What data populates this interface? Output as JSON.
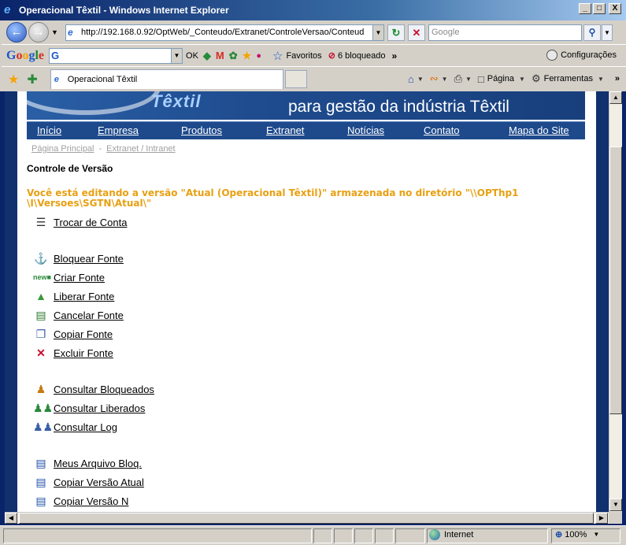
{
  "window": {
    "title": "Operacional Têxtil - Windows Internet Explorer",
    "minimize": "_",
    "maximize": "□",
    "close": "X"
  },
  "addressbar": {
    "url": "http://192.168.0.92/OptWeb/_Conteudo/Extranet/ControleVersao/Conteud",
    "search_placeholder": "Google"
  },
  "googlebar": {
    "ok_label": "OK",
    "favorites_label": "Favoritos",
    "blocked_label": "6 bloqueado",
    "more_label": "»",
    "settings_label": "Configurações"
  },
  "tabbar": {
    "tab_title": "Operacional Têxtil",
    "page_label": "Página",
    "tools_label": "Ferramentas",
    "more_label": "»"
  },
  "site": {
    "logo_text": "Têxtil",
    "slogan": "para gestão da indústria Têxtil",
    "nav": [
      "Início",
      "Empresa",
      "Produtos",
      "Extranet",
      "Notícias",
      "Contato",
      "Mapa do Site"
    ],
    "breadcrumb": {
      "home": "Página Principal",
      "separator": "-",
      "current": "Extranet / Intranet"
    },
    "page_title": "Controle de Versão",
    "notice": "Você está editando a versão \"Atual (Operacional Têxtil)\" armazenada no diretório \"\\\\OPThp1\n\\I\\Versoes\\SGTN\\Atual\\\"",
    "menu": [
      {
        "label": "Trocar de Conta",
        "icon": "list-icon"
      },
      {
        "label": "Bloquear Fonte",
        "icon": "lock-icon"
      },
      {
        "label": "Criar Fonte",
        "icon": "new-folder-icon"
      },
      {
        "label": "Liberar Fonte",
        "icon": "release-folder-icon"
      },
      {
        "label": "Cancelar Fonte",
        "icon": "cancel-doc-icon"
      },
      {
        "label": "Copiar Fonte",
        "icon": "copy-icon"
      },
      {
        "label": "Excluir Fonte",
        "icon": "delete-icon"
      },
      {
        "label": "Consultar Bloqueados",
        "icon": "people-icon"
      },
      {
        "label": "Consultar Liberados",
        "icon": "people-green-icon"
      },
      {
        "label": "Consultar Log",
        "icon": "people-search-icon"
      },
      {
        "label": "Meus Arquivo Bloq.",
        "icon": "disk-icon"
      },
      {
        "label": "Copiar Versão Atual",
        "icon": "disk-icon"
      },
      {
        "label": "Copiar Versão N",
        "icon": "disk-icon"
      }
    ]
  },
  "statusbar": {
    "zone": "Internet",
    "zoom": "100%"
  }
}
